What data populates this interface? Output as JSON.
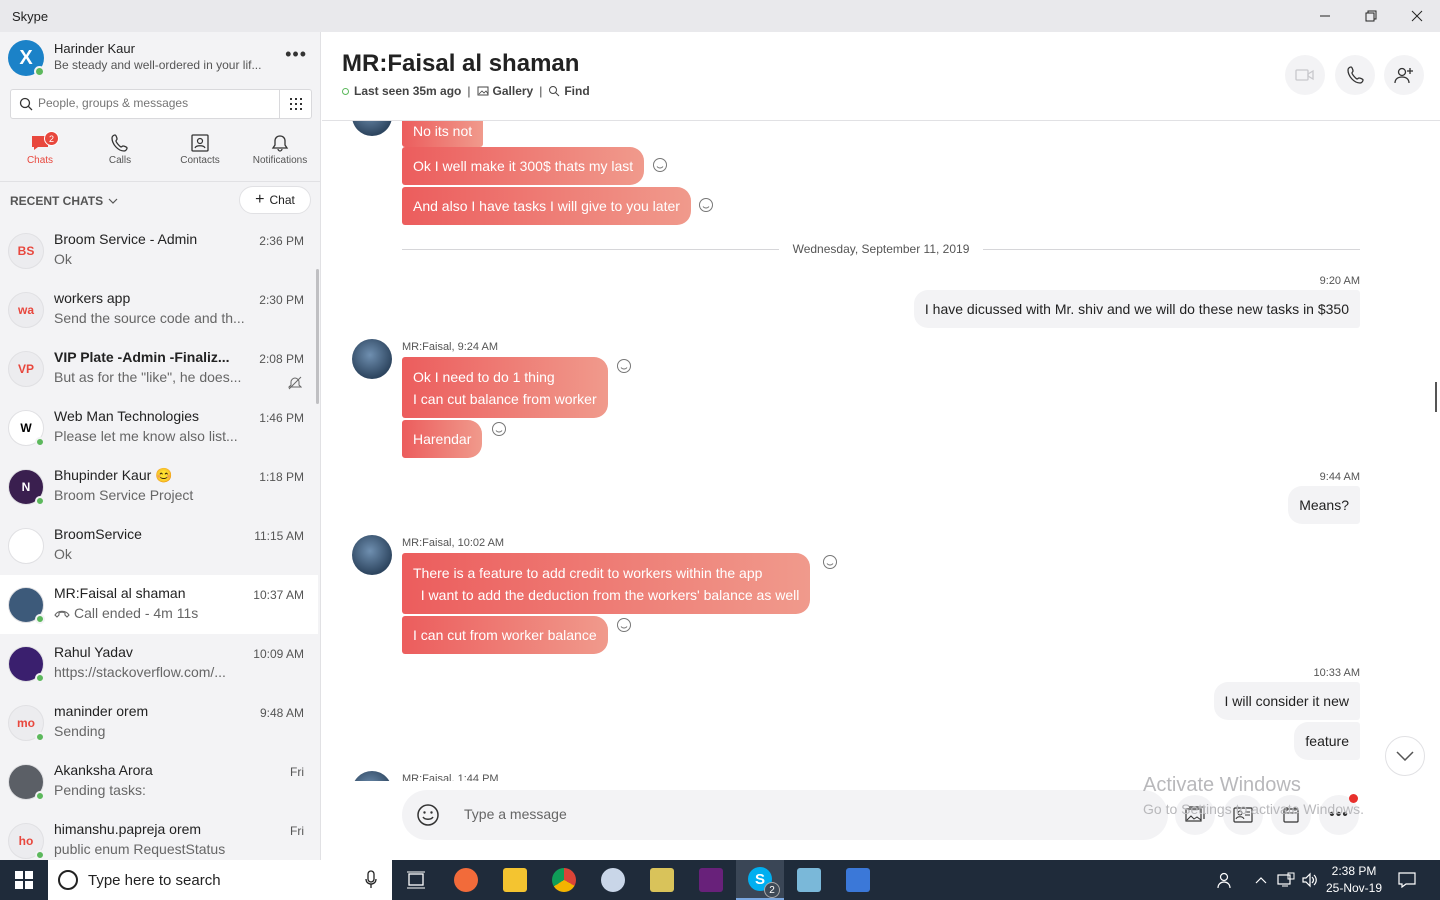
{
  "window": {
    "title": "Skype"
  },
  "profile": {
    "name": "Harinder Kaur",
    "mood": "Be steady and well-ordered in your lif...",
    "avatar_letter": "X"
  },
  "search": {
    "placeholder": "People, groups & messages"
  },
  "nav": {
    "tabs": [
      {
        "label": "Chats",
        "icon": "chat-icon",
        "badge": "2",
        "active": true
      },
      {
        "label": "Calls",
        "icon": "phone-icon"
      },
      {
        "label": "Contacts",
        "icon": "contacts-icon"
      },
      {
        "label": "Notifications",
        "icon": "bell-icon"
      }
    ]
  },
  "recent": {
    "header": "RECENT CHATS",
    "new_chat_label": "Chat"
  },
  "chats": [
    {
      "initials": "BS",
      "name": "Broom Service - Admin",
      "preview": "Ok",
      "time": "2:36 PM",
      "avatar_bg": "#ececef",
      "avatar_fg": "#e8473d"
    },
    {
      "initials": "wa",
      "name": "workers app",
      "preview": "Send the source code and th...",
      "time": "2:30 PM",
      "avatar_bg": "#ececef",
      "avatar_fg": "#e8473d"
    },
    {
      "initials": "VP",
      "name": "VIP Plate -Admin -Finaliz...",
      "preview": "But as for the \"like\", he does...",
      "time": "2:08 PM",
      "bold": true,
      "muted": true,
      "avatar_bg": "#ececef",
      "avatar_fg": "#e8473d"
    },
    {
      "initials": "W",
      "name": "Web Man Technologies",
      "preview": "Please let me know also list...",
      "time": "1:46 PM",
      "online": true,
      "avatar_bg": "#ffffff",
      "avatar_fg": "#000000"
    },
    {
      "initials": "N",
      "name": "Bhupinder Kaur 😊",
      "preview": "Broom Service Project",
      "time": "1:18 PM",
      "online": true,
      "avatar_bg": "#3a1f4f",
      "avatar_fg": "#ffffff"
    },
    {
      "initials": "",
      "name": "BroomService",
      "preview": "Ok",
      "time": "11:15 AM",
      "avatar_bg": "#ffffff",
      "avatar_fg": "#333333"
    },
    {
      "initials": "",
      "name": "MR:Faisal al shaman",
      "preview": "Call ended - 4m 11s",
      "time": "10:37 AM",
      "online": true,
      "selected": true,
      "call": true,
      "avatar_bg": "#3d5a7a",
      "avatar_fg": "#ffffff"
    },
    {
      "initials": "",
      "name": "Rahul Yadav",
      "preview": "https://stackoverflow.com/...",
      "time": "10:09 AM",
      "online": true,
      "avatar_bg": "#3a1f6e",
      "avatar_fg": "#ffffff"
    },
    {
      "initials": "mo",
      "name": "maninder orem",
      "preview": "Sending",
      "time": "9:48 AM",
      "online": true,
      "avatar_bg": "#ececef",
      "avatar_fg": "#e8473d"
    },
    {
      "initials": "",
      "name": "Akanksha Arora",
      "preview": "Pending tasks:",
      "time": "Fri",
      "online": true,
      "avatar_bg": "#5b5f66",
      "avatar_fg": "#ffffff"
    },
    {
      "initials": "ho",
      "name": "himanshu.papreja orem",
      "preview": " public enum RequestStatus",
      "time": "Fri",
      "online": true,
      "avatar_bg": "#ececef",
      "avatar_fg": "#e8473d"
    }
  ],
  "conversation": {
    "title": "MR:Faisal al shaman",
    "last_seen": "Last seen 35m ago",
    "gallery": "Gallery",
    "find": "Find",
    "sep": "|",
    "date_divider": "Wednesday, September 11, 2019",
    "messages": {
      "m1": "No its not",
      "m2": "Ok I well make it 300$ thats my last",
      "m3": "And also I have tasks I will give to you later",
      "t1": "9:20 AM",
      "o1": "I have dicussed with Mr. shiv and we will do these new tasks in $350",
      "s1": "MR:Faisal, 9:24 AM",
      "m4a": "Ok I need to do 1 thing",
      "m4b": "I can cut balance from worker",
      "m5": "Harendar",
      "t2": "9:44 AM",
      "o2": "Means?",
      "s2": "MR:Faisal, 10:02 AM",
      "m6a": "There is a feature to add credit to workers within the app",
      "m6b": "  I want to add the deduction from the workers' balance as well",
      "m7": "I can cut from worker balance",
      "t3": "10:33 AM",
      "o3": "I will consider it new",
      "o4": "feature",
      "s3": "MR:Faisal, 1:44 PM"
    },
    "composer_placeholder": "Type a message"
  },
  "watermark": {
    "line1": "Activate Windows",
    "line2": "Go to Settings to activate Windows."
  },
  "taskbar": {
    "search_text": "Type here to search",
    "skype_badge": "2",
    "time": "2:38 PM",
    "date": "25-Nov-19"
  }
}
